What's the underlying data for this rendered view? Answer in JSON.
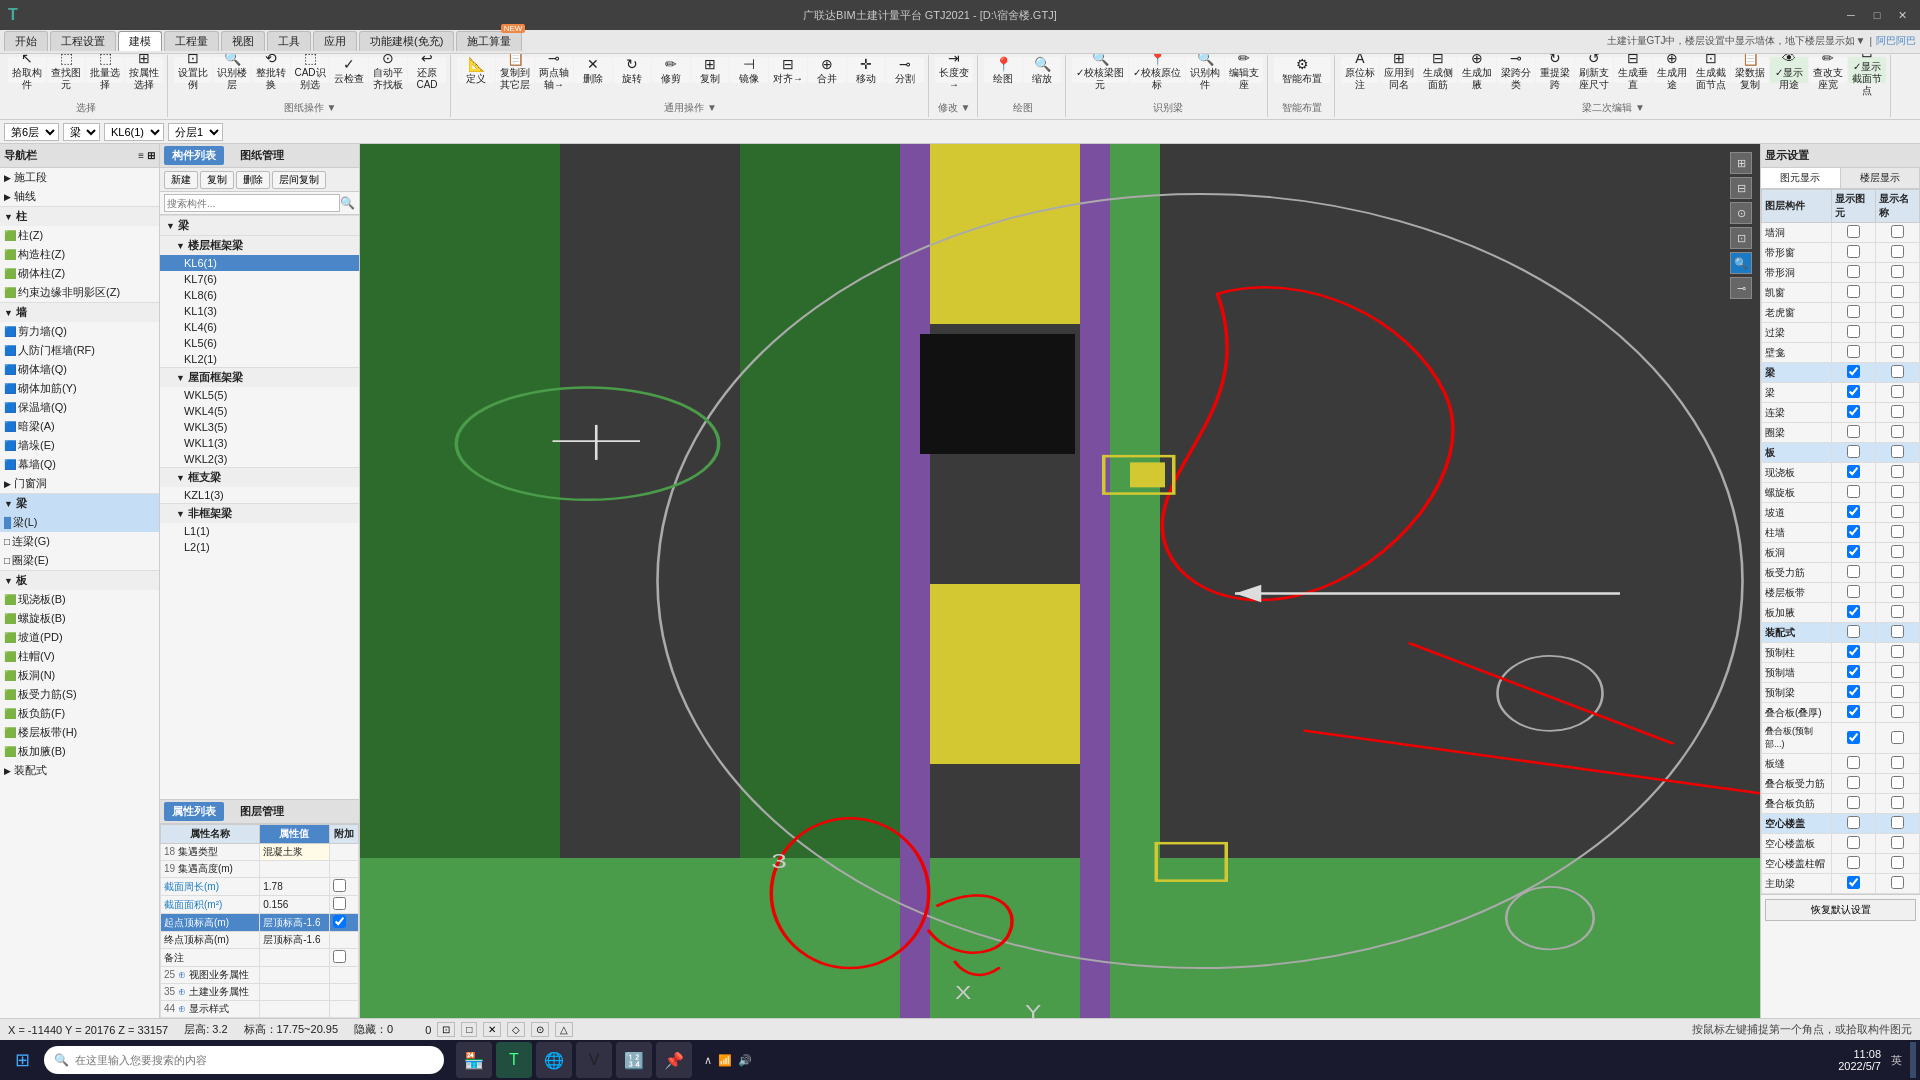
{
  "titlebar": {
    "title": "广联达BIM土建计量平台 GTJ2021 - [D:\\宿舍楼.GTJ]",
    "minimize": "─",
    "maximize": "□",
    "close": "✕"
  },
  "toolbar": {
    "tabs": [
      "开始",
      "工程设置",
      "建模",
      "工程量",
      "视图",
      "工具",
      "应用",
      "功能建模(免充)",
      "施工算量"
    ],
    "active_tab": "建模"
  },
  "secondary_toolbar": {
    "floor": "第6层",
    "component_type": "梁",
    "beam_size": "KL6(1)",
    "layer": "分层1"
  },
  "left_panel": {
    "title": "导航栏",
    "sections": [
      {
        "label": "施工段"
      },
      {
        "label": "轴线"
      },
      {
        "label": "柱",
        "items": [
          "柱(Z)",
          "构造柱(Z)",
          "砌体柱(Z)",
          "约束边缘非明影区(Z)"
        ]
      },
      {
        "label": "墙",
        "items": [
          "剪力墙(Q)",
          "人防门框墙(RF)",
          "砌体墙(Q)",
          "砌体加筋(Y)",
          "保温墙(Q)",
          "暗梁(A)",
          "墙垛(E)",
          "幕墙(Q)"
        ]
      },
      {
        "label": "门窗洞"
      },
      {
        "label": "梁",
        "selected": true,
        "items": [
          "梁(L)",
          "连梁(G)",
          "圈梁(E)"
        ]
      },
      {
        "label": "板",
        "items": [
          "现浇板(B)",
          "螺旋板(B)",
          "坡道(PD)",
          "柱帽(V)",
          "板洞(N)",
          "板受力筋(S)",
          "板负筋(F)",
          "楼层板带(H)",
          "板加腋(B)"
        ]
      },
      {
        "label": "装配式"
      }
    ]
  },
  "component_panel": {
    "tabs": [
      "构件列表",
      "图纸管理"
    ],
    "active_tab": "构件列表",
    "toolbar": [
      "新建",
      "复制",
      "删除",
      "层间复制"
    ],
    "search_placeholder": "搜索构件...",
    "tree": [
      {
        "type": "section",
        "label": "梁",
        "expanded": true
      },
      {
        "type": "section",
        "label": "楼层框架梁",
        "level": 1,
        "expanded": true
      },
      {
        "type": "item",
        "label": "KL6(1)",
        "level": 2,
        "selected": true
      },
      {
        "type": "item",
        "label": "KL7(6)",
        "level": 2
      },
      {
        "type": "item",
        "label": "KL8(6)",
        "level": 2
      },
      {
        "type": "item",
        "label": "KL1(3)",
        "level": 2
      },
      {
        "type": "item",
        "label": "KL4(6)",
        "level": 2
      },
      {
        "type": "item",
        "label": "KL5(6)",
        "level": 2
      },
      {
        "type": "item",
        "label": "KL2(1)",
        "level": 2
      },
      {
        "type": "section",
        "label": "屋面框架梁",
        "level": 1,
        "expanded": true
      },
      {
        "type": "item",
        "label": "WKL5(5)",
        "level": 2
      },
      {
        "type": "item",
        "label": "WKL4(5)",
        "level": 2
      },
      {
        "type": "item",
        "label": "WKL3(5)",
        "level": 2
      },
      {
        "type": "item",
        "label": "WKL1(3)",
        "level": 2
      },
      {
        "type": "item",
        "label": "WKL2(3)",
        "level": 2
      },
      {
        "type": "section",
        "label": "框支梁",
        "level": 1,
        "expanded": true
      },
      {
        "type": "item",
        "label": "KZL1(3)",
        "level": 2
      },
      {
        "type": "section",
        "label": "非框架梁",
        "level": 1,
        "expanded": true
      },
      {
        "type": "item",
        "label": "L1(1)",
        "level": 2
      },
      {
        "type": "item",
        "label": "L2(1)",
        "level": 2
      }
    ]
  },
  "properties_panel": {
    "tabs": [
      "属性列表",
      "图层管理"
    ],
    "active_tab": "属性列表",
    "columns": [
      "属性名称",
      "属性值",
      "附加"
    ],
    "rows": [
      {
        "id": 18,
        "name": "集遇类型",
        "value": "混凝土浆",
        "editable": false,
        "addon": false
      },
      {
        "id": 19,
        "name": "集遇高度(m)",
        "value": "",
        "editable": false,
        "addon": false
      },
      {
        "id": 20,
        "name": "截面周长(m)",
        "value": "1.78",
        "editable": true,
        "addon": false
      },
      {
        "id": 21,
        "name": "截面面积(m²)",
        "value": "0.156",
        "editable": false,
        "addon": true
      },
      {
        "id": 22,
        "name": "起点顶标高(m)",
        "value": "层顶标高-1.6",
        "editable": true,
        "addon": true,
        "highlight": true
      },
      {
        "id": 23,
        "name": "终点顶标高(m)",
        "value": "层顶标高-1.6",
        "editable": false,
        "addon": false
      },
      {
        "id": 24,
        "name": "备注",
        "value": "",
        "editable": false,
        "addon": false
      },
      {
        "id": 25,
        "name": "视图业务属性",
        "value": "",
        "editable": false,
        "addon": false,
        "expandable": true
      },
      {
        "id": 35,
        "name": "土建业务属性",
        "value": "",
        "editable": false,
        "addon": false,
        "expandable": true
      },
      {
        "id": 44,
        "name": "显示样式",
        "value": "",
        "editable": false,
        "addon": false,
        "expandable": true
      }
    ]
  },
  "right_panel": {
    "title": "显示设置",
    "tabs": [
      "图元显示",
      "楼层显示"
    ],
    "active_tab": "图元显示",
    "columns": [
      "图层构件",
      "显示图元",
      "显示名称"
    ],
    "rows": [
      {
        "label": "墙洞",
        "show_element": false,
        "show_name": false
      },
      {
        "label": "带形窗",
        "show_element": false,
        "show_name": false
      },
      {
        "label": "带形洞",
        "show_element": false,
        "show_name": false
      },
      {
        "label": "凯窗",
        "show_element": false,
        "show_name": false
      },
      {
        "label": "老虎窗",
        "show_element": false,
        "show_name": false
      },
      {
        "label": "过梁",
        "show_element": false,
        "show_name": false
      },
      {
        "label": "壁龛",
        "show_element": false,
        "show_name": false
      },
      {
        "label": "梁",
        "show_element": true,
        "show_name": false,
        "is_section": true
      },
      {
        "label": "梁",
        "show_element": true,
        "show_name": false
      },
      {
        "label": "连梁",
        "show_element": true,
        "show_name": false
      },
      {
        "label": "圈梁",
        "show_element": false,
        "show_name": false
      },
      {
        "label": "板",
        "show_element": false,
        "show_name": false,
        "is_section": true
      },
      {
        "label": "现浇板",
        "show_element": true,
        "show_name": false
      },
      {
        "label": "螺旋板",
        "show_element": false,
        "show_name": false
      },
      {
        "label": "坡道",
        "show_element": true,
        "show_name": false
      },
      {
        "label": "柱墙",
        "show_element": true,
        "show_name": false
      },
      {
        "label": "板洞",
        "show_element": true,
        "show_name": false
      },
      {
        "label": "板受力筋",
        "show_element": false,
        "show_name": false
      },
      {
        "label": "楼层板带",
        "show_element": false,
        "show_name": false
      },
      {
        "label": "板加腋",
        "show_element": true,
        "show_name": false
      },
      {
        "label": "装配式",
        "show_element": false,
        "show_name": false,
        "is_section": true
      },
      {
        "label": "预制柱",
        "show_element": true,
        "show_name": false
      },
      {
        "label": "预制墙",
        "show_element": true,
        "show_name": false
      },
      {
        "label": "预制梁",
        "show_element": true,
        "show_name": false
      },
      {
        "label": "叠合板(叠厚)",
        "show_element": true,
        "show_name": false
      },
      {
        "label": "叠合板(预制部...)",
        "show_element": true,
        "show_name": false
      },
      {
        "label": "板缝",
        "show_element": false,
        "show_name": false
      },
      {
        "label": "叠合板受力筋",
        "show_element": false,
        "show_name": false
      },
      {
        "label": "叠合板负筋",
        "show_element": false,
        "show_name": false
      },
      {
        "label": "空心楼盖",
        "show_element": false,
        "show_name": false,
        "is_section": true
      },
      {
        "label": "空心楼盖板",
        "show_element": false,
        "show_name": false
      },
      {
        "label": "空心楼盖柱帽",
        "show_element": false,
        "show_name": false
      },
      {
        "label": "主助梁",
        "show_element": true,
        "show_name": false
      }
    ],
    "restore_defaults": "恢复默认设置"
  },
  "status_bar": {
    "coords": "X = -11440  Y = 20176  Z = 33157",
    "floor_height": "层高: 3.2",
    "scale": "标高：17.75~20.95",
    "hidden_count": "隐藏：0",
    "hint": "按鼠标左键捕捉第一个角点，或拾取构件图元",
    "snap_info": "0"
  },
  "taskbar": {
    "search_placeholder": "在这里输入您要搜索的内容",
    "time": "11:08",
    "date": "2022/5/7",
    "lang": "英"
  }
}
